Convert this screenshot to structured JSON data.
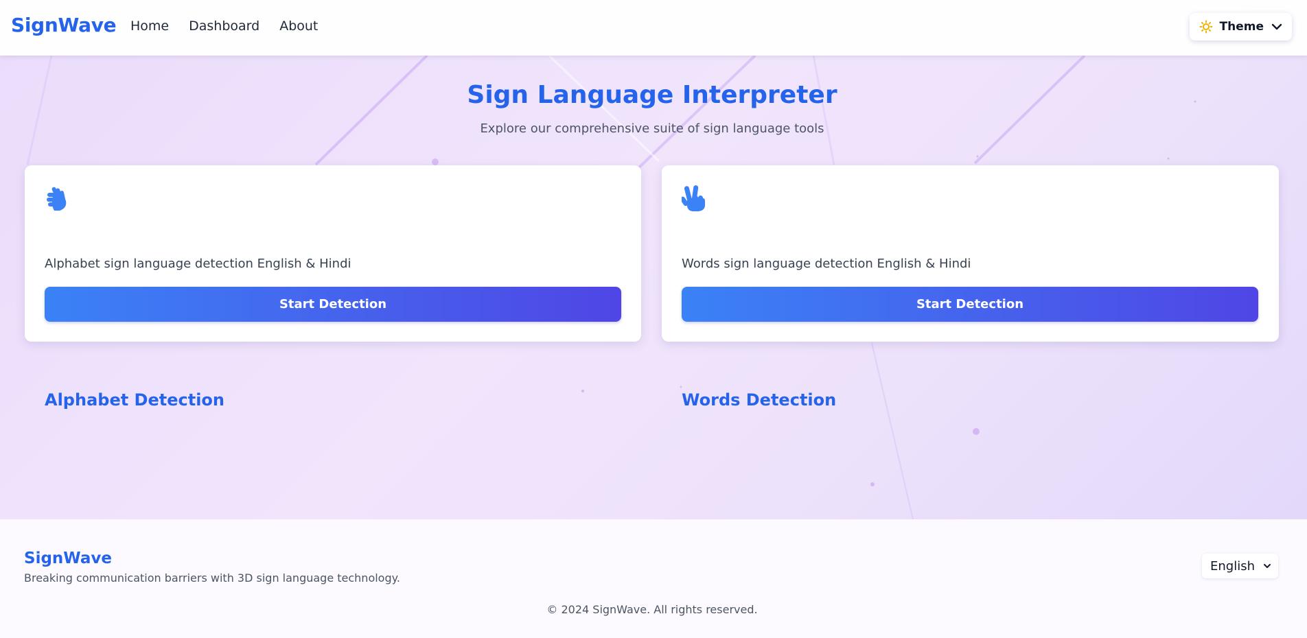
{
  "header": {
    "logo": "SignWave",
    "nav": [
      "Home",
      "Dashboard",
      "About"
    ],
    "theme_label": "Theme",
    "theme_icon": "sun-icon"
  },
  "hero": {
    "title": "Sign Language Interpreter",
    "subtitle": "Explore our comprehensive suite of sign language tools"
  },
  "cards": [
    {
      "icon": "sign-language-hands-icon",
      "title": "Alphabet Detection",
      "description": "Alphabet sign language detection English & Hindi",
      "button": "Start Detection"
    },
    {
      "icon": "peace-hand-icon",
      "title": "Words Detection",
      "description": "Words sign language detection English & Hindi",
      "button": "Start Detection"
    }
  ],
  "footer": {
    "logo": "SignWave",
    "tagline": "Breaking communication barriers with 3D sign language technology.",
    "language": "English",
    "copyright": "© 2024 SignWave. All rights reserved."
  },
  "colors": {
    "accent": "#2563eb",
    "button_gradient_start": "#3b82f6",
    "button_gradient_end": "#4f46e5",
    "theme_icon": "#eab308"
  }
}
